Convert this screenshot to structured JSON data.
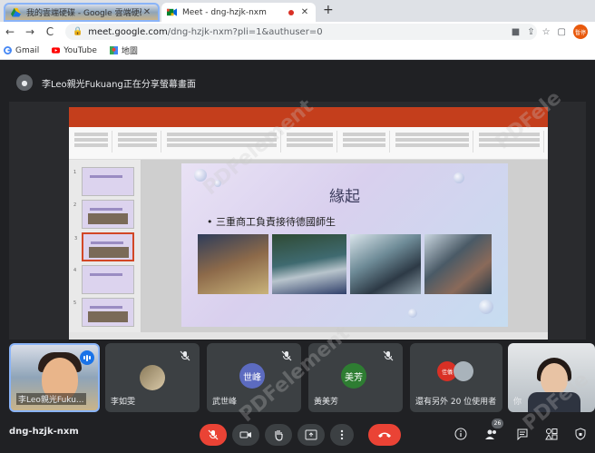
{
  "browser": {
    "tabs": [
      {
        "title": "我的雲端硬碟 - Google 雲端硬碟",
        "active": false
      },
      {
        "title": "Meet - dng-hzjk-nxm",
        "active": true
      }
    ],
    "new_tab_symbol": "+",
    "close_symbol": "✕",
    "nav": {
      "back": "←",
      "forward": "→",
      "reload": "C"
    },
    "url": {
      "host": "meet.google.com",
      "path": "/dng-hzjk-nxm?pli=1&authuser=0"
    },
    "profile_label": "暫停",
    "bookmarks": [
      {
        "label": "Gmail",
        "icon": "google-icon"
      },
      {
        "label": "YouTube",
        "icon": "youtube-icon"
      },
      {
        "label": "地圖",
        "icon": "maps-icon"
      }
    ]
  },
  "meet": {
    "presenting_text": "李Leo親光Fukuang正在分享螢幕畫面",
    "shared_slide": {
      "title": "緣起",
      "bullet": "• 三重商工負責接待德國師生",
      "slide_numbers": [
        "1",
        "2",
        "3",
        "4",
        "5"
      ]
    },
    "participants": [
      {
        "name": "李Leo親光Fuku...",
        "type": "video"
      },
      {
        "name": "李如雯",
        "type": "photo"
      },
      {
        "name": "武世峰",
        "initials": "世峰",
        "color": "#5c6bc0"
      },
      {
        "name": "黃美芳",
        "initials": "美芳",
        "color": "#2e7d32"
      },
      {
        "name": "還有另外 20 位使用者",
        "avatars": [
          "佳儀",
          "user"
        ]
      },
      {
        "name": "你",
        "type": "video"
      }
    ],
    "meeting_code": "dng-hzjk-nxm",
    "people_count": "26",
    "colors": {
      "accent": "#8ab4f8",
      "danger": "#ea4335",
      "surface": "#3c4043",
      "background": "#202124"
    }
  },
  "watermark": "Wondershare PDFelement"
}
